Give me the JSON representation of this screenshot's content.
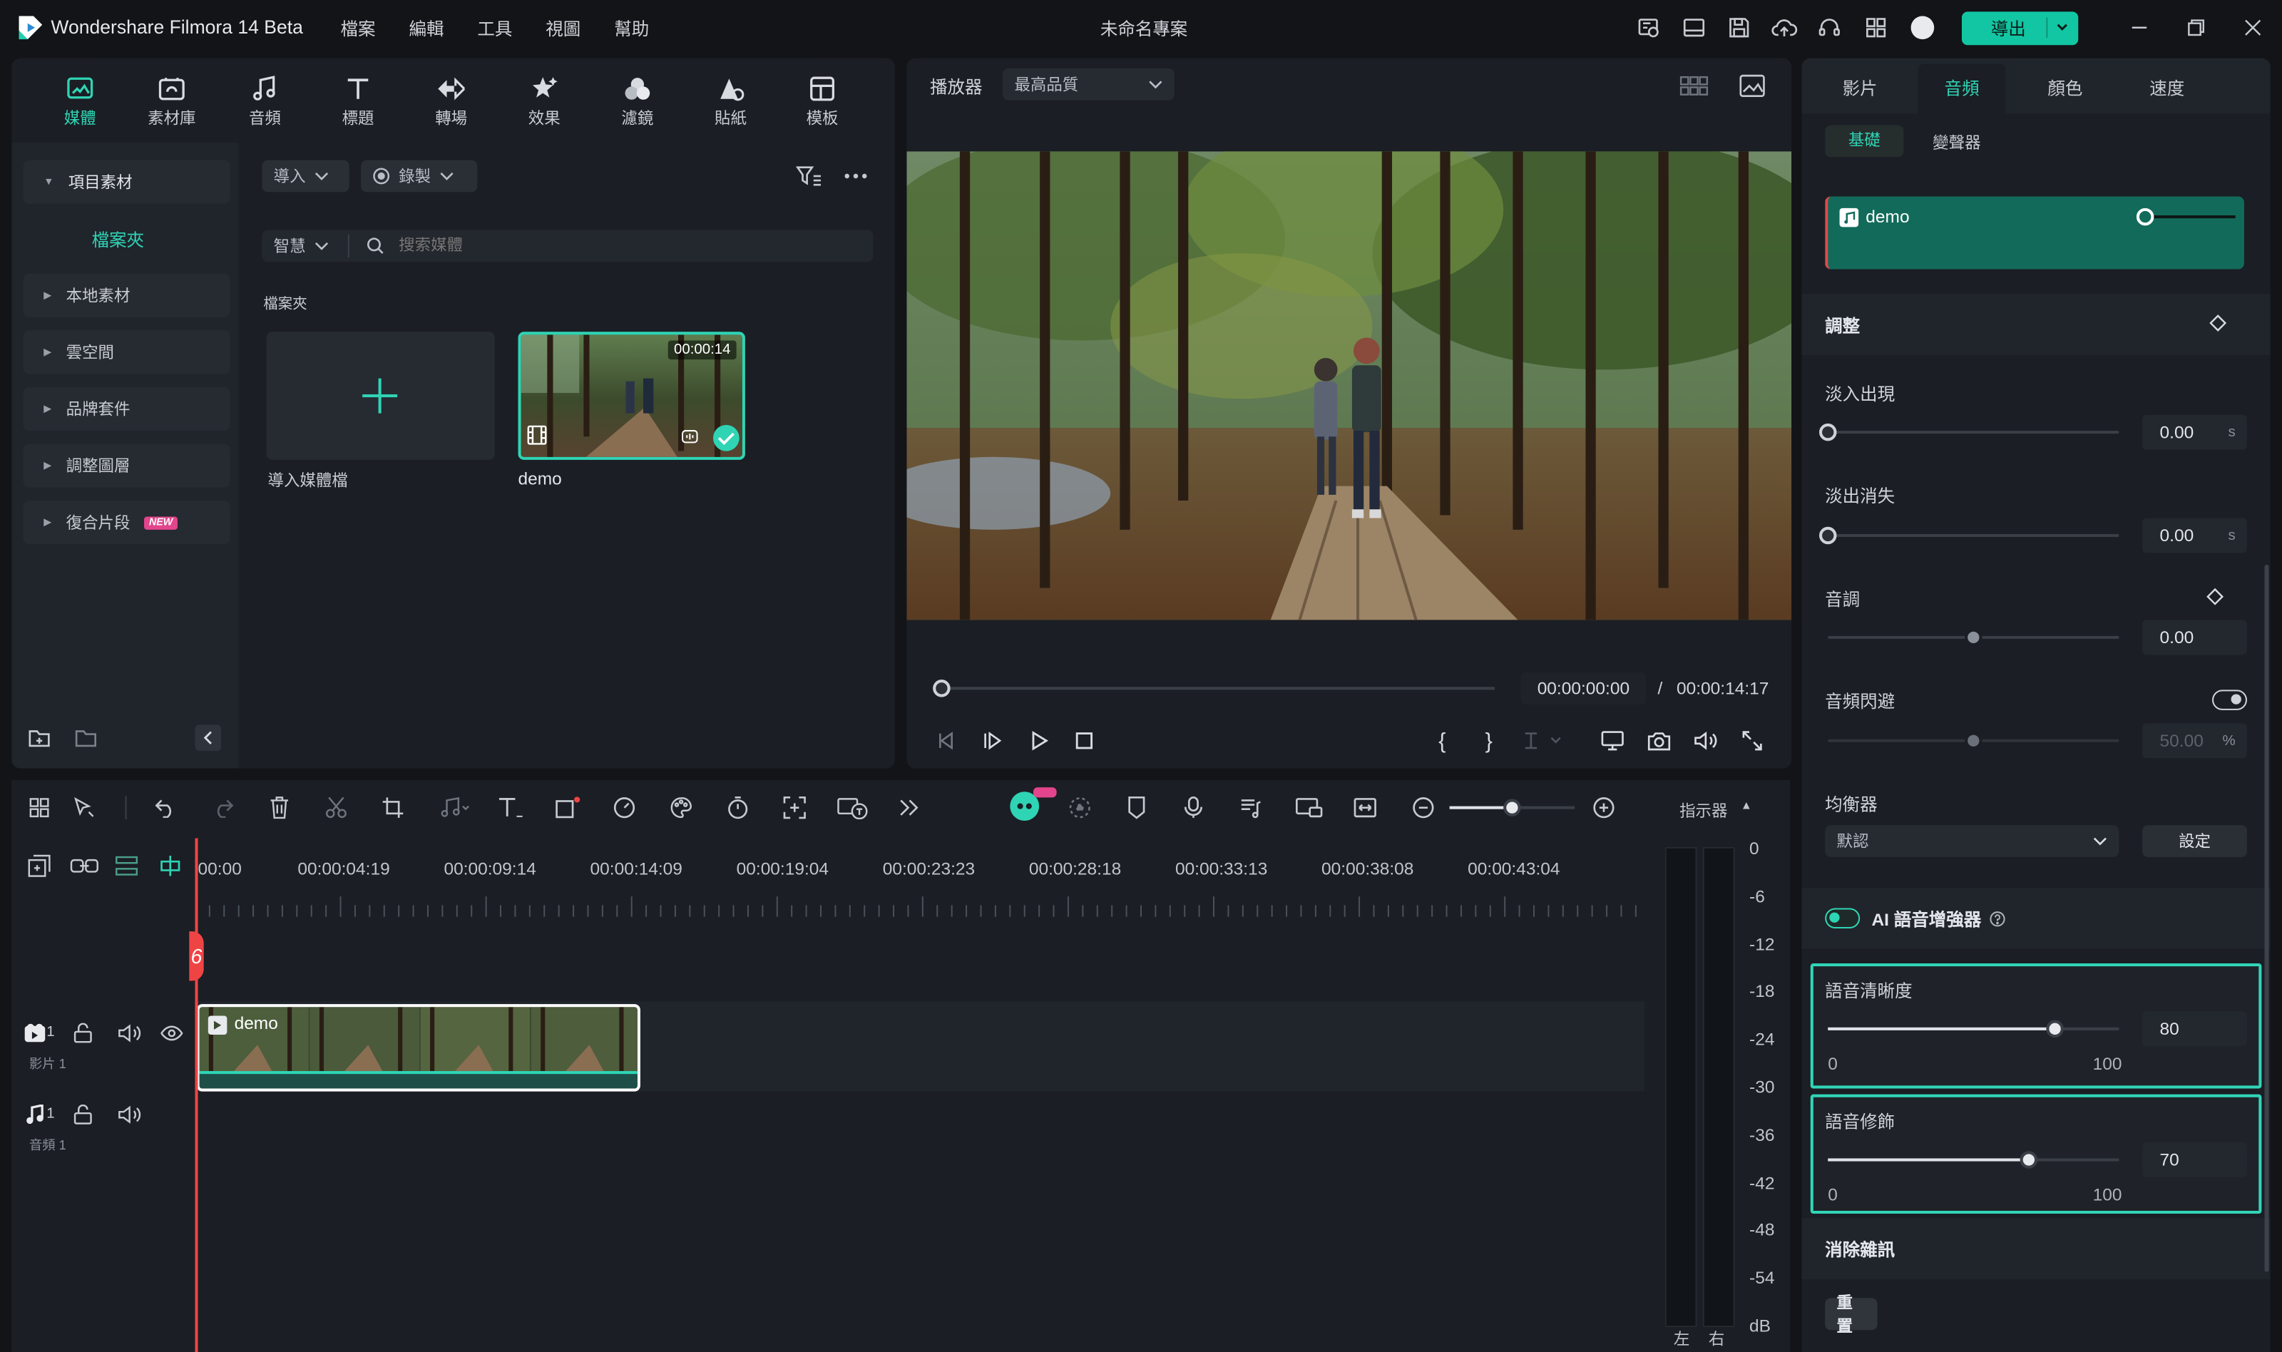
{
  "app": {
    "title": "Wondershare Filmora 14 Beta",
    "project_name": "未命名專案"
  },
  "menu": [
    "檔案",
    "編輯",
    "工具",
    "視圖",
    "幫助"
  ],
  "export_label": "導出",
  "media_tabs": [
    {
      "label": "媒體",
      "icon": "media-icon",
      "active": true
    },
    {
      "label": "素材庫",
      "icon": "stock-library-icon"
    },
    {
      "label": "音頻",
      "icon": "music-note-icon"
    },
    {
      "label": "標題",
      "icon": "title-t-icon"
    },
    {
      "label": "轉場",
      "icon": "transition-icon"
    },
    {
      "label": "效果",
      "icon": "effects-star-icon"
    },
    {
      "label": "濾鏡",
      "icon": "filter-circles-icon"
    },
    {
      "label": "貼紙",
      "icon": "sticker-icon"
    },
    {
      "label": "模板",
      "icon": "template-icon"
    }
  ],
  "sidebar": {
    "project_media": "項目素材",
    "folder": "檔案夾",
    "items": [
      {
        "label": "本地素材"
      },
      {
        "label": "雲空間"
      },
      {
        "label": "品牌套件"
      },
      {
        "label": "調整圖層"
      },
      {
        "label": "復合片段",
        "badge": "NEW"
      }
    ]
  },
  "media": {
    "import_label": "導入",
    "record_label": "錄製",
    "smart_label": "智慧",
    "search_placeholder": "搜索媒體",
    "folder_heading": "檔案夾",
    "import_tile_label": "導入媒體檔",
    "clip_name": "demo",
    "clip_duration": "00:00:14"
  },
  "player": {
    "label": "播放器",
    "quality": "最高品質",
    "current_time": "00:00:00:00",
    "separator": "/",
    "total_time": "00:00:14:17",
    "progress": 0
  },
  "right_panel": {
    "tabs": [
      "影片",
      "音頻",
      "顏色",
      "速度"
    ],
    "active_tab": "音頻",
    "subtabs": [
      "基礎",
      "變聲器"
    ],
    "clip_name": "demo",
    "adjust_heading": "調整",
    "fade_in": {
      "label": "淡入出現",
      "value": "0.00",
      "unit": "s",
      "level": 0
    },
    "fade_out": {
      "label": "淡出消失",
      "value": "0.00",
      "unit": "s",
      "level": 0
    },
    "pitch": {
      "label": "音調",
      "value": "0.00",
      "level": 0.5
    },
    "ducking": {
      "label": "音頻閃避",
      "value": "50.00",
      "unit": "%",
      "level": 0.5,
      "enabled": false
    },
    "equalizer": {
      "label": "均衡器",
      "preset": "默認",
      "settings_label": "設定"
    },
    "ai_enhancer": {
      "label": "AI 語音增強器",
      "enabled": true
    },
    "clarity": {
      "label": "語音清晰度",
      "value": "80",
      "min": "0",
      "max": "100",
      "level": 0.78
    },
    "beautify": {
      "label": "語音修飾",
      "value": "70",
      "min": "0",
      "max": "100",
      "level": 0.69
    },
    "denoise_heading": "消除雜訊",
    "reset_label": "重置"
  },
  "timeline": {
    "ruler": [
      "00:00",
      "00:00:04:19",
      "00:00:09:14",
      "00:00:14:09",
      "00:00:19:04",
      "00:00:23:23",
      "00:00:28:18",
      "00:00:33:13",
      "00:00:38:08",
      "00:00:43:04"
    ],
    "video_track": {
      "index": "1",
      "name": "影片 1",
      "clip": "demo"
    },
    "audio_track": {
      "index": "1",
      "name": "音頻 1"
    },
    "zoom_level": 0.5,
    "playhead_marker": "6"
  },
  "meter": {
    "label": "指示器",
    "scale": [
      "0",
      "-6",
      "-12",
      "-18",
      "-24",
      "-30",
      "-36",
      "-42",
      "-48",
      "-54",
      "dB"
    ],
    "left": "左",
    "right": "右"
  },
  "colors": {
    "accent": "#12c6a3",
    "panel": "#1b1e24",
    "bg": "#121418",
    "highlight": "#31d5b7",
    "playhead": "#ef4444"
  }
}
